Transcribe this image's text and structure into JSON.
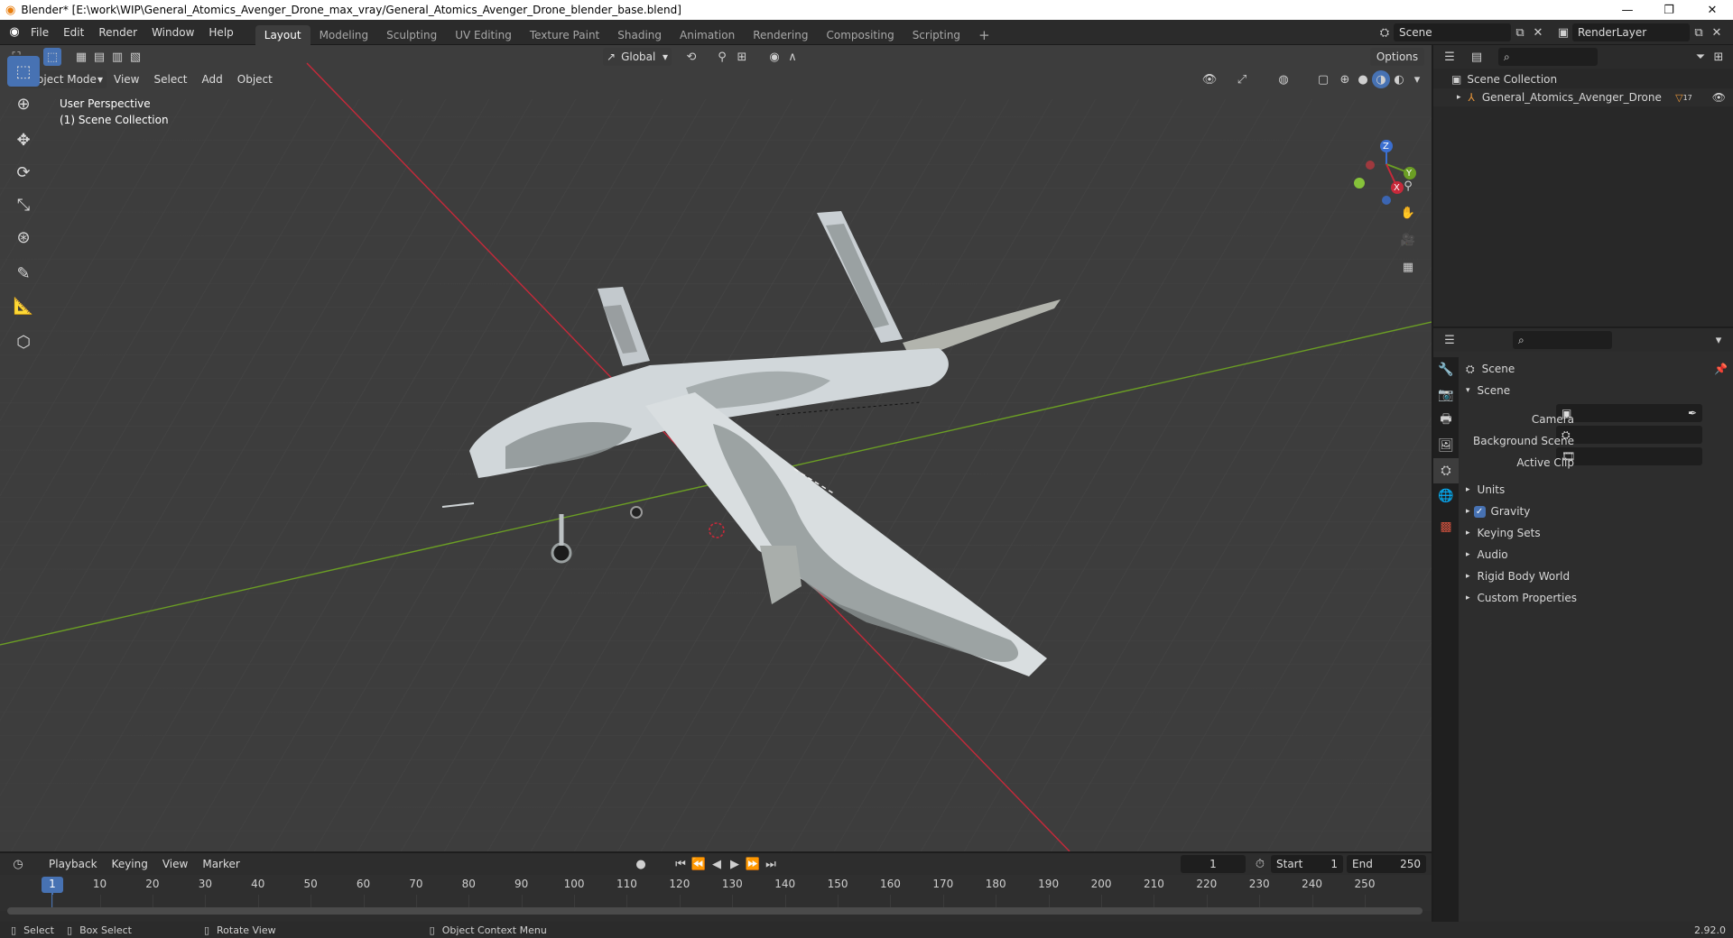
{
  "window": {
    "title": "Blender* [E:\\work\\WIP\\General_Atomics_Avenger_Drone_max_vray/General_Atomics_Avenger_Drone_blender_base.blend]",
    "minimize": "—",
    "maximize": "❐",
    "close": "✕"
  },
  "menu": {
    "items": [
      "File",
      "Edit",
      "Render",
      "Window",
      "Help"
    ]
  },
  "workspaces": {
    "tabs": [
      "Layout",
      "Modeling",
      "Sculpting",
      "UV Editing",
      "Texture Paint",
      "Shading",
      "Animation",
      "Rendering",
      "Compositing",
      "Scripting"
    ],
    "active": "Layout",
    "add": "+"
  },
  "scene_selector": {
    "value": "Scene"
  },
  "layer_selector": {
    "value": "RenderLayer"
  },
  "viewport": {
    "transform_orientation": "Global",
    "options_label": "Options",
    "mode": "Object Mode",
    "menus": [
      "View",
      "Select",
      "Add",
      "Object"
    ],
    "overlay_line1": "User Perspective",
    "overlay_line2": "(1) Scene Collection",
    "gizmo": {
      "x": "X",
      "y": "Y",
      "z": "Z"
    }
  },
  "outliner": {
    "root": "Scene Collection",
    "items": [
      {
        "name": "General_Atomics_Avenger_Drone",
        "count": "17"
      }
    ]
  },
  "properties": {
    "context": "Scene",
    "panel": "Scene",
    "fields": [
      {
        "label": "Camera",
        "value": ""
      },
      {
        "label": "Background Scene",
        "value": ""
      },
      {
        "label": "Active Clip",
        "value": ""
      }
    ],
    "subpanels": [
      "Units",
      "Gravity",
      "Keying Sets",
      "Audio",
      "Rigid Body World",
      "Custom Properties"
    ],
    "gravity_checked": true
  },
  "timeline": {
    "menus": [
      "Playback",
      "Keying",
      "View",
      "Marker"
    ],
    "current_frame": "1",
    "start_label": "Start",
    "start": "1",
    "end_label": "End",
    "end": "250",
    "ruler": [
      "1",
      "10",
      "20",
      "30",
      "40",
      "50",
      "60",
      "70",
      "80",
      "90",
      "100",
      "110",
      "120",
      "130",
      "140",
      "150",
      "160",
      "170",
      "180",
      "190",
      "200",
      "210",
      "220",
      "230",
      "240",
      "250"
    ]
  },
  "statusbar": {
    "select": "Select",
    "box_select": "Box Select",
    "rotate_view": "Rotate View",
    "context_menu": "Object Context Menu",
    "version": "2.92.0"
  },
  "colors": {
    "accent": "#4772b3",
    "x_axis": "#c7293a",
    "y_axis": "#6b9e24",
    "z_axis": "#3b6fd0"
  }
}
